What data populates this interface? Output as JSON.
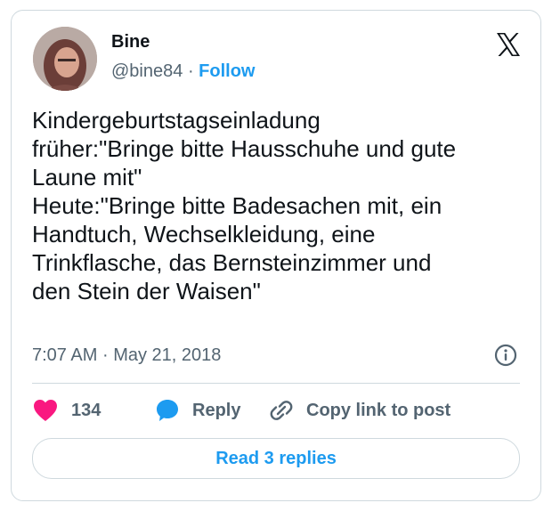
{
  "author": {
    "name": "Bine",
    "handle": "@bine84",
    "separator": "·",
    "follow_label": "Follow"
  },
  "tweet": {
    "text": "Kindergeburtstagseinladung\nfrüher:\"Bringe bitte Hausschuhe und gute\nLaune mit\"\nHeute:\"Bringe bitte Badesachen mit, ein\nHandtuch, Wechselkleidung, eine\nTrinkflasche, das Bernsteinzimmer und\nden Stein der Waisen\"",
    "time": "7:07 AM",
    "separator": "·",
    "date": "May 21, 2018"
  },
  "actions": {
    "like_count": "134",
    "reply_label": "Reply",
    "copy_label": "Copy link to post"
  },
  "read_replies_label": "Read 3 replies",
  "icons": {
    "logo": "x-logo-icon",
    "info": "info-icon",
    "like": "heart-icon",
    "reply": "speech-bubble-icon",
    "copy": "link-icon"
  },
  "colors": {
    "accent": "#1d9bf0",
    "like": "#f91880",
    "muted": "#536471",
    "border": "#cfd9de",
    "text": "#0f1419"
  }
}
